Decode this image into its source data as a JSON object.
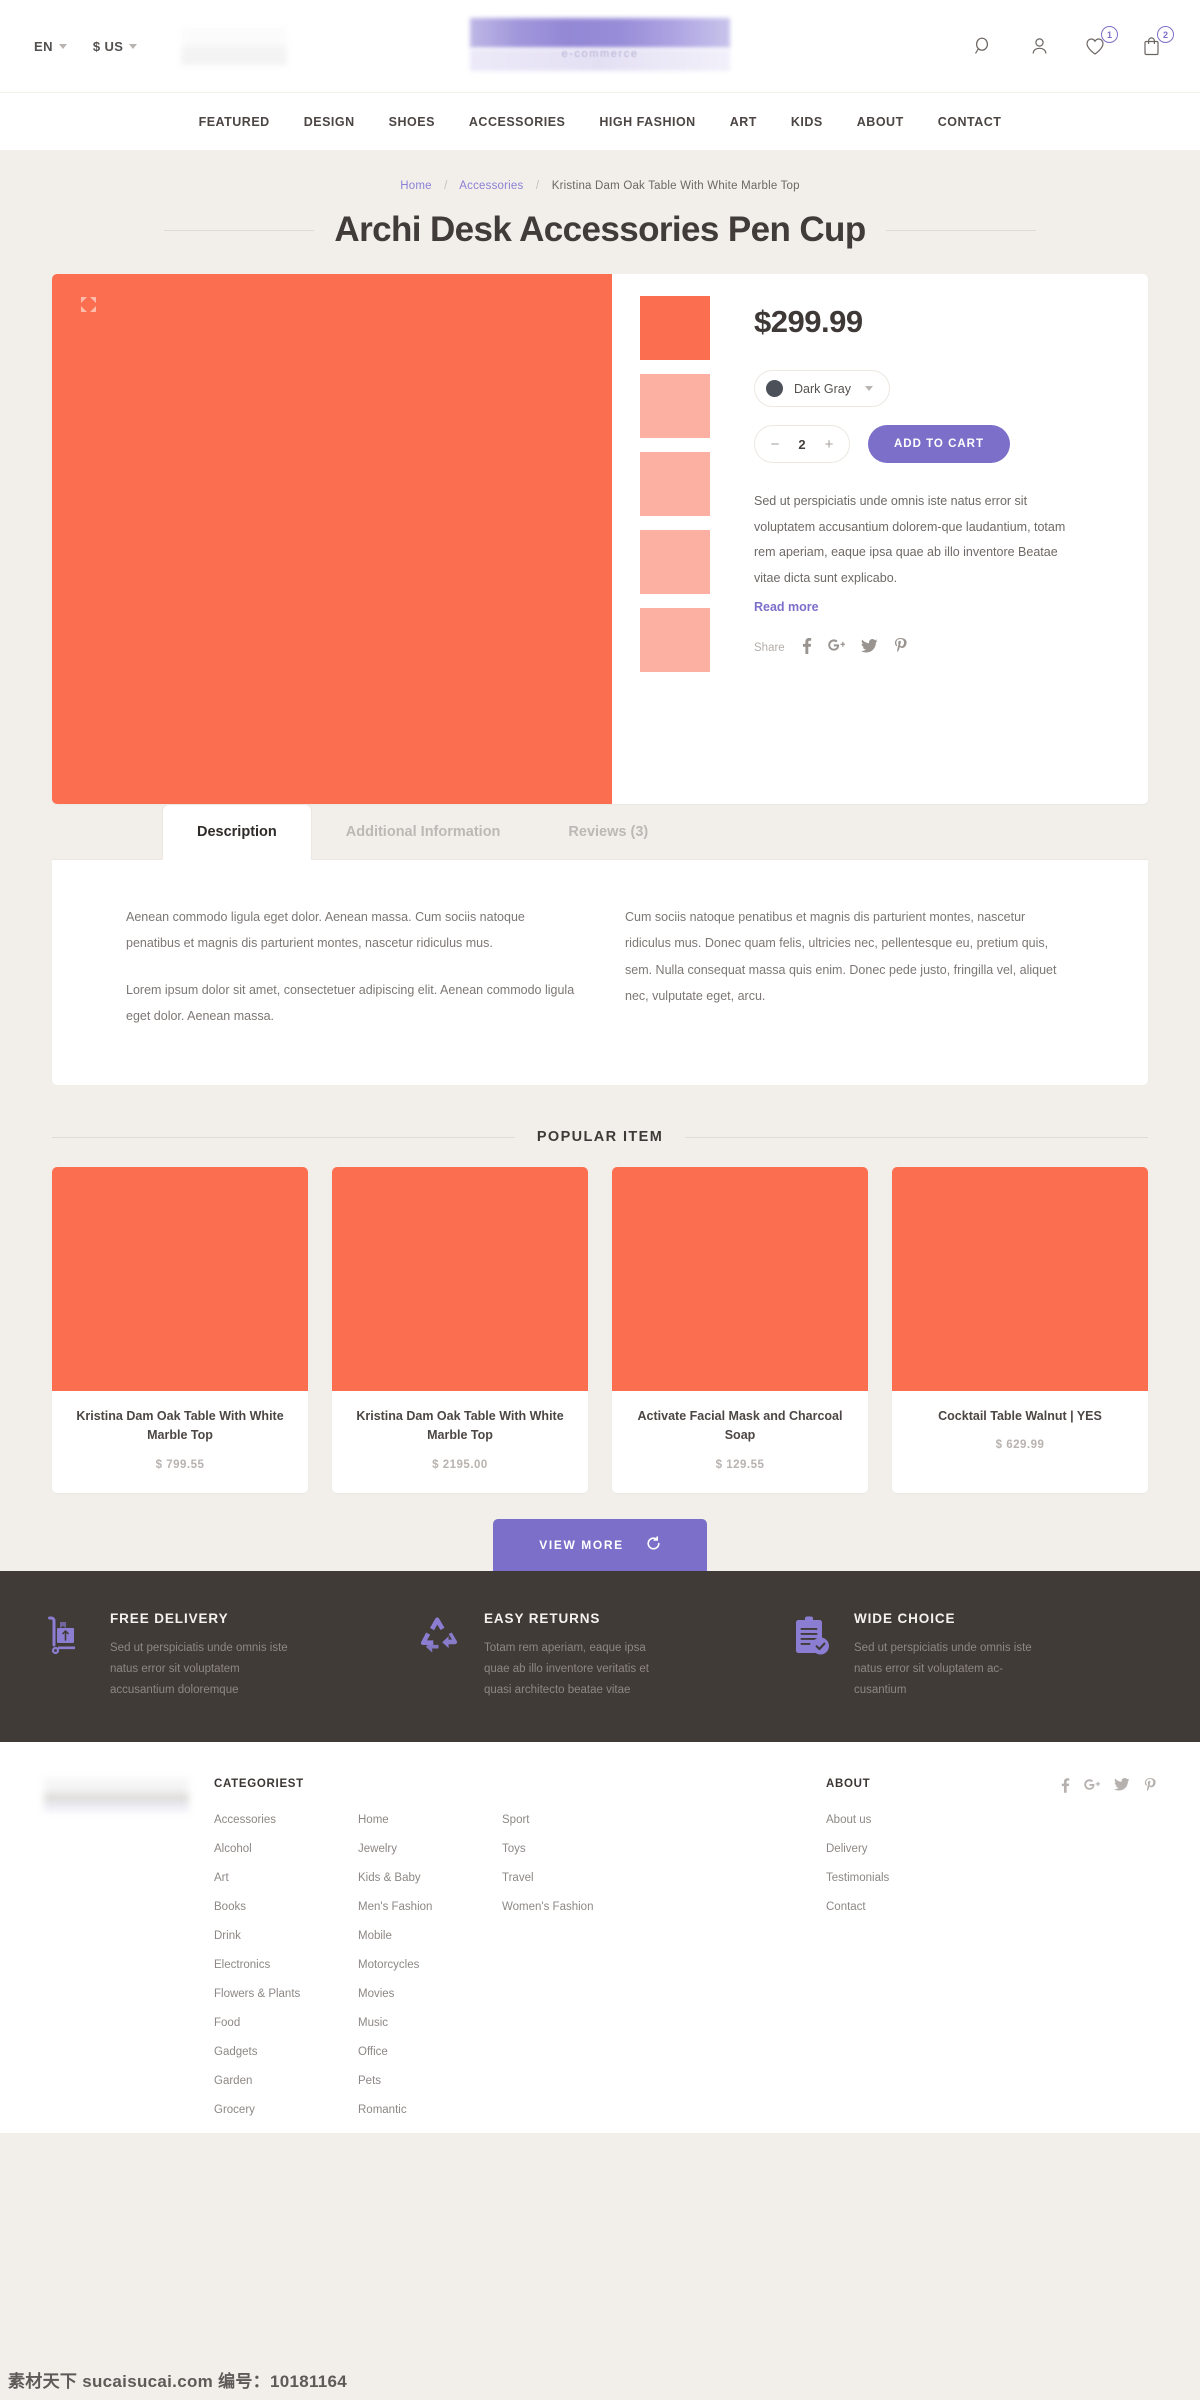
{
  "topbar": {
    "language": "EN",
    "currency": "$ US",
    "logo_subtitle": "e-commerce",
    "icons": {
      "search": "search-icon",
      "account": "user-icon",
      "wishlist": "heart-icon",
      "cart": "bag-icon"
    },
    "wishlist_count": "1",
    "cart_count": "2"
  },
  "nav": [
    {
      "label": "FEATURED"
    },
    {
      "label": "DESIGN"
    },
    {
      "label": "SHOES"
    },
    {
      "label": "ACCESSORIES"
    },
    {
      "label": "HIGH FASHION"
    },
    {
      "label": "ART"
    },
    {
      "label": "KIDS"
    },
    {
      "label": "ABOUT"
    },
    {
      "label": "CONTACT"
    }
  ],
  "breadcrumb": {
    "home": "Home",
    "category": "Accessories",
    "current": "Kristina Dam Oak Table With White Marble Top",
    "separator": "/"
  },
  "page_title": "Archi Desk Accessories Pen Cup",
  "product": {
    "price": "$299.99",
    "color_label": "Dark Gray",
    "color_swatch": "#4c5059",
    "quantity": "2",
    "decrement_label": "−",
    "increment_label": "+",
    "add_to_cart": "ADD TO CART",
    "description": "Sed ut perspiciatis unde omnis iste natus error sit voluptatem accusantium dolorem-que laudantium, totam rem aperiam, eaque ipsa quae ab illo inventore Beatae vitae dicta sunt explicabo.",
    "read_more": "Read more",
    "share_label": "Share",
    "share_icons": [
      "facebook-icon",
      "google-plus-icon",
      "twitter-icon",
      "pinterest-icon"
    ],
    "main_image_color": "#fb6f50",
    "thumbs": [
      {
        "color": "#fb6f50",
        "active": true
      },
      {
        "color": "#fcb0a2",
        "active": false
      },
      {
        "color": "#fcb0a2",
        "active": false
      },
      {
        "color": "#fcb0a2",
        "active": false
      },
      {
        "color": "#fcb0a2",
        "active": false
      }
    ]
  },
  "tabs": [
    {
      "label": "Description",
      "active": true
    },
    {
      "label": "Additional Information",
      "active": false
    },
    {
      "label": "Reviews (3)",
      "active": false
    }
  ],
  "tab_content": {
    "left_p1": "Aenean commodo ligula eget dolor. Aenean massa. Cum sociis natoque penatibus et magnis dis parturient montes, nascetur ridiculus mus.",
    "left_p2": "Lorem ipsum dolor sit amet, consectetuer adipiscing elit. Aenean commodo ligula eget dolor. Aenean massa.",
    "right_p1": "Cum sociis natoque penatibus et magnis dis parturient montes, nascetur ridiculus mus. Donec quam felis, ultricies nec, pellentesque eu, pretium quis, sem. Nulla consequat massa quis enim. Donec pede justo, fringilla vel, aliquet nec, vulputate eget, arcu."
  },
  "popular": {
    "heading": "POPULAR ITEM",
    "items": [
      {
        "name": "Kristina Dam Oak Table With White Marble Top",
        "price": "$ 799.55",
        "color": "#fb6f50"
      },
      {
        "name": "Kristina Dam Oak Table With White Marble Top",
        "price": "$ 2195.00",
        "color": "#fb6f50"
      },
      {
        "name": "Activate Facial Mask and Charcoal Soap",
        "price": "$ 129.55",
        "color": "#fb6f50"
      },
      {
        "name": "Cocktail Table Walnut | YES",
        "price": "$ 629.99",
        "color": "#fb6f50"
      }
    ],
    "view_more": "VIEW MORE"
  },
  "features": [
    {
      "icon": "delivery-truck-icon",
      "title": "FREE DELIVERY",
      "text": "Sed ut perspiciatis unde omnis iste natus error sit voluptatem accusantium doloremque"
    },
    {
      "icon": "recycle-icon",
      "title": "EASY RETURNS",
      "text": "Totam rem aperiam, eaque ipsa quae ab illo inventore veritatis et quasi architecto beatae vitae"
    },
    {
      "icon": "clipboard-check-icon",
      "title": "WIDE CHOICE",
      "text": "Sed ut perspiciatis unde omnis iste natus error sit voluptatem ac-cusantium"
    }
  ],
  "footer": {
    "categories_title": "CATEGORIEST",
    "about_title": "ABOUT",
    "col1": [
      "Accessories",
      "Alcohol",
      "Art",
      "Books",
      "Drink",
      "Electronics",
      "Flowers & Plants",
      "Food",
      "Gadgets",
      "Garden",
      "Grocery"
    ],
    "col2": [
      "Home",
      "Jewelry",
      "Kids & Baby",
      "Men's Fashion",
      "Mobile",
      "Motorcycles",
      "Movies",
      "Music",
      "Office",
      "Pets",
      "Romantic"
    ],
    "col3": [
      "Sport",
      "Toys",
      "Travel",
      "Women's Fashion"
    ],
    "about_links": [
      "About us",
      "Delivery",
      "Testimonials",
      "Contact"
    ],
    "social": [
      "facebook-icon",
      "google-plus-icon",
      "twitter-icon",
      "pinterest-icon"
    ]
  },
  "watermark": "素材天下 sucaisucai.com 编号：10181164",
  "colors": {
    "accent_purple": "#7b6fc9",
    "product_coral": "#fb6f50",
    "thumb_faded": "#fcb0a2",
    "dark_bar": "#413b38",
    "page_bg": "#f2efeb"
  }
}
